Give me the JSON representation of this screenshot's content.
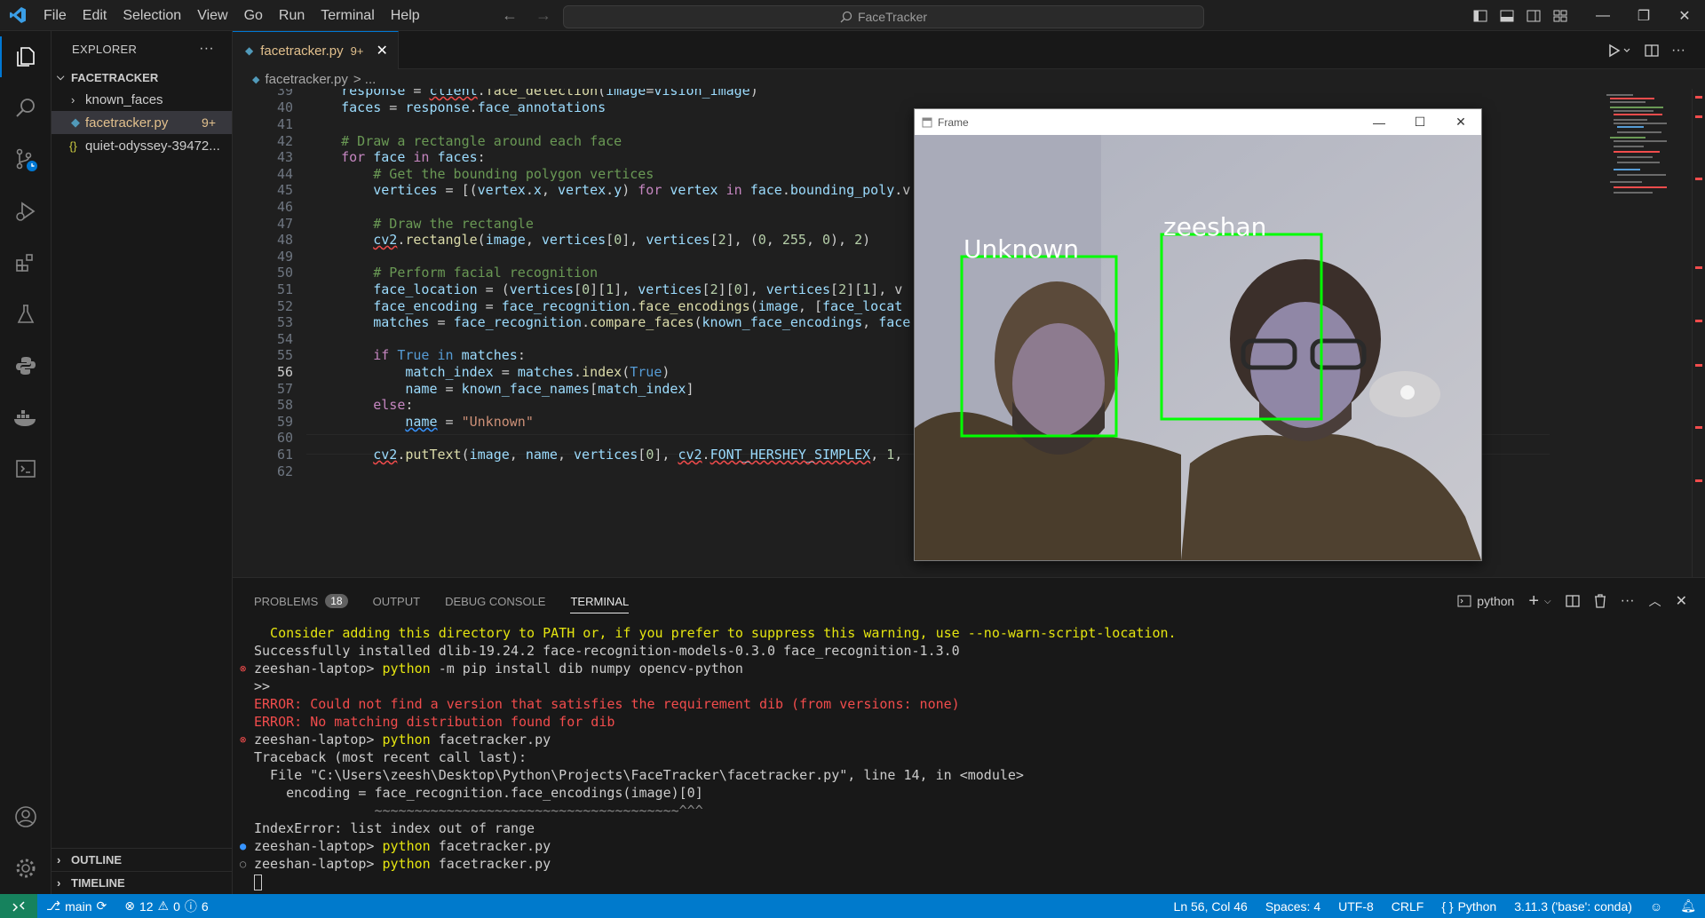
{
  "window": {
    "command_center": "FaceTracker"
  },
  "menu": [
    "File",
    "Edit",
    "Selection",
    "View",
    "Go",
    "Run",
    "Terminal",
    "Help"
  ],
  "explorer": {
    "title": "EXPLORER",
    "more": "···",
    "folder": "FACETRACKER",
    "items": [
      {
        "label": "known_faces",
        "type": "folder"
      },
      {
        "label": "facetracker.py",
        "type": "python",
        "badge": "9+"
      },
      {
        "label": "quiet-odyssey-39472...",
        "type": "json"
      }
    ],
    "outline": "OUTLINE",
    "timeline": "TIMELINE"
  },
  "tab": {
    "name": "facetracker.py",
    "count": "9+",
    "close": "✕"
  },
  "breadcrumb": {
    "file": "facetracker.py",
    "rest": "> ..."
  },
  "editor": {
    "line_numbers": [
      "39",
      "40",
      "41",
      "42",
      "43",
      "44",
      "45",
      "46",
      "47",
      "48",
      "49",
      "50",
      "51",
      "52",
      "53",
      "54",
      "55",
      "56",
      "57",
      "58",
      "59",
      "60",
      "61",
      "62"
    ],
    "current_line": "56"
  },
  "frame_window": {
    "title": "Frame",
    "labels": [
      "Unknown",
      "zeeshan"
    ]
  },
  "panel": {
    "tabs": [
      "PROBLEMS",
      "OUTPUT",
      "DEBUG CONSOLE",
      "TERMINAL"
    ],
    "problems_count": "18",
    "terminal_name": "python",
    "terminal_lines": [
      {
        "text": "  Consider adding this directory to PATH or, if you prefer to suppress this warning, use --no-warn-script-location.",
        "color": "ty"
      },
      {
        "text": "Successfully installed dlib-19.24.2 face-recognition-models-0.3.0 face_recognition-1.3.0",
        "color": "tw"
      },
      {
        "prompt": "zeeshan-laptop> ",
        "cmd": "python",
        "args": " -m pip install dib numpy opencv-python",
        "dot": "err"
      },
      {
        "text": ">>",
        "color": "tw"
      },
      {
        "text": "ERROR: Could not find a version that satisfies the requirement dib (from versions: none)",
        "color": "tr"
      },
      {
        "text": "ERROR: No matching distribution found for dib",
        "color": "tr"
      },
      {
        "prompt": "zeeshan-laptop> ",
        "cmd": "python",
        "args": " facetracker.py",
        "dot": "err"
      },
      {
        "text": "Traceback (most recent call last):",
        "color": "tw"
      },
      {
        "text": "  File \"C:\\Users\\zeesh\\Desktop\\Python\\Projects\\FaceTracker\\facetracker.py\", line 14, in <module>",
        "color": "tw"
      },
      {
        "text": "    encoding = face_recognition.face_encodings(image)[0]",
        "color": "tw"
      },
      {
        "text": "               ~~~~~~~~~~~~~~~~~~~~~~~~~~~~~~~~~~~~~~^^^",
        "color": "tg"
      },
      {
        "text": "IndexError: list index out of range",
        "color": "tw"
      },
      {
        "prompt": "zeeshan-laptop> ",
        "cmd": "python",
        "args": " facetracker.py",
        "dot": "blue"
      },
      {
        "prompt": "zeeshan-laptop> ",
        "cmd": "python",
        "args": " facetracker.py",
        "dot": "hollow"
      }
    ]
  },
  "status": {
    "branch": "main",
    "errors": "12",
    "warnings": "0",
    "info": "6",
    "position": "Ln 56, Col 46",
    "spaces": "Spaces: 4",
    "encoding": "UTF-8",
    "eol": "CRLF",
    "language": "Python",
    "interpreter": "3.11.3 ('base': conda)"
  },
  "colors": {
    "accent": "#007acc",
    "remote": "#16825d",
    "face_box": "#00ff00"
  }
}
